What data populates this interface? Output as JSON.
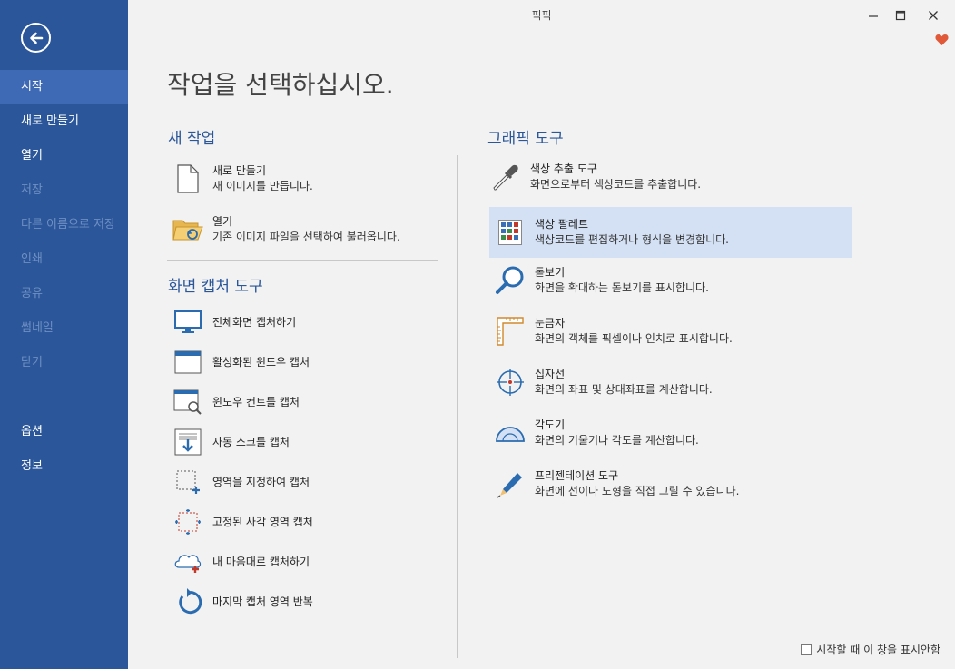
{
  "window": {
    "title": "픽픽"
  },
  "sidebar": {
    "items": [
      {
        "label": "시작"
      },
      {
        "label": "새로 만들기"
      },
      {
        "label": "열기"
      },
      {
        "label": "저장"
      },
      {
        "label": "다른 이름으로 저장"
      },
      {
        "label": "인쇄"
      },
      {
        "label": "공유"
      },
      {
        "label": "썸네일"
      },
      {
        "label": "닫기"
      },
      {
        "label": "옵션"
      },
      {
        "label": "정보"
      }
    ]
  },
  "main": {
    "heading": "작업을 선택하십시오.",
    "new_task": {
      "title": "새 작업",
      "items": [
        {
          "label": "새로 만들기",
          "desc": "새 이미지를 만듭니다."
        },
        {
          "label": "열기",
          "desc": "기존 이미지 파일을 선택하여 불러옵니다."
        }
      ]
    },
    "capture": {
      "title": "화면 캡처 도구",
      "items": [
        {
          "label": "전체화면 캡처하기"
        },
        {
          "label": "활성화된 윈도우 캡처"
        },
        {
          "label": "윈도우 컨트롤 캡처"
        },
        {
          "label": "자동 스크롤 캡처"
        },
        {
          "label": "영역을 지정하여 캡처"
        },
        {
          "label": "고정된 사각 영역 캡처"
        },
        {
          "label": "내 마음대로 캡처하기"
        },
        {
          "label": "마지막 캡처 영역 반복"
        }
      ]
    },
    "graphic": {
      "title": "그래픽 도구",
      "items": [
        {
          "label": "색상 추출 도구",
          "desc": "화면으로부터 색상코드를 추출합니다."
        },
        {
          "label": "색상 팔레트",
          "desc": "색상코드를 편집하거나 형식을 변경합니다."
        },
        {
          "label": "돋보기",
          "desc": "화면을 확대하는 돋보기를 표시합니다."
        },
        {
          "label": "눈금자",
          "desc": "화면의 객체를 픽셀이나 인치로 표시합니다."
        },
        {
          "label": "십자선",
          "desc": "화면의 좌표 및 상대좌표를 계산합니다."
        },
        {
          "label": "각도기",
          "desc": "화면의 기울기나 각도를 계산합니다."
        },
        {
          "label": "프리젠테이션 도구",
          "desc": "화면에 선이나 도형을 직접 그릴 수 있습니다."
        }
      ]
    }
  },
  "footer": {
    "checkbox_label": "시작할 때 이 창을 표시안함"
  },
  "colors": {
    "sidebar": "#2b579a",
    "active": "#3e6ab5",
    "highlight": "#d4e1f4",
    "accent": "#2b579a"
  }
}
